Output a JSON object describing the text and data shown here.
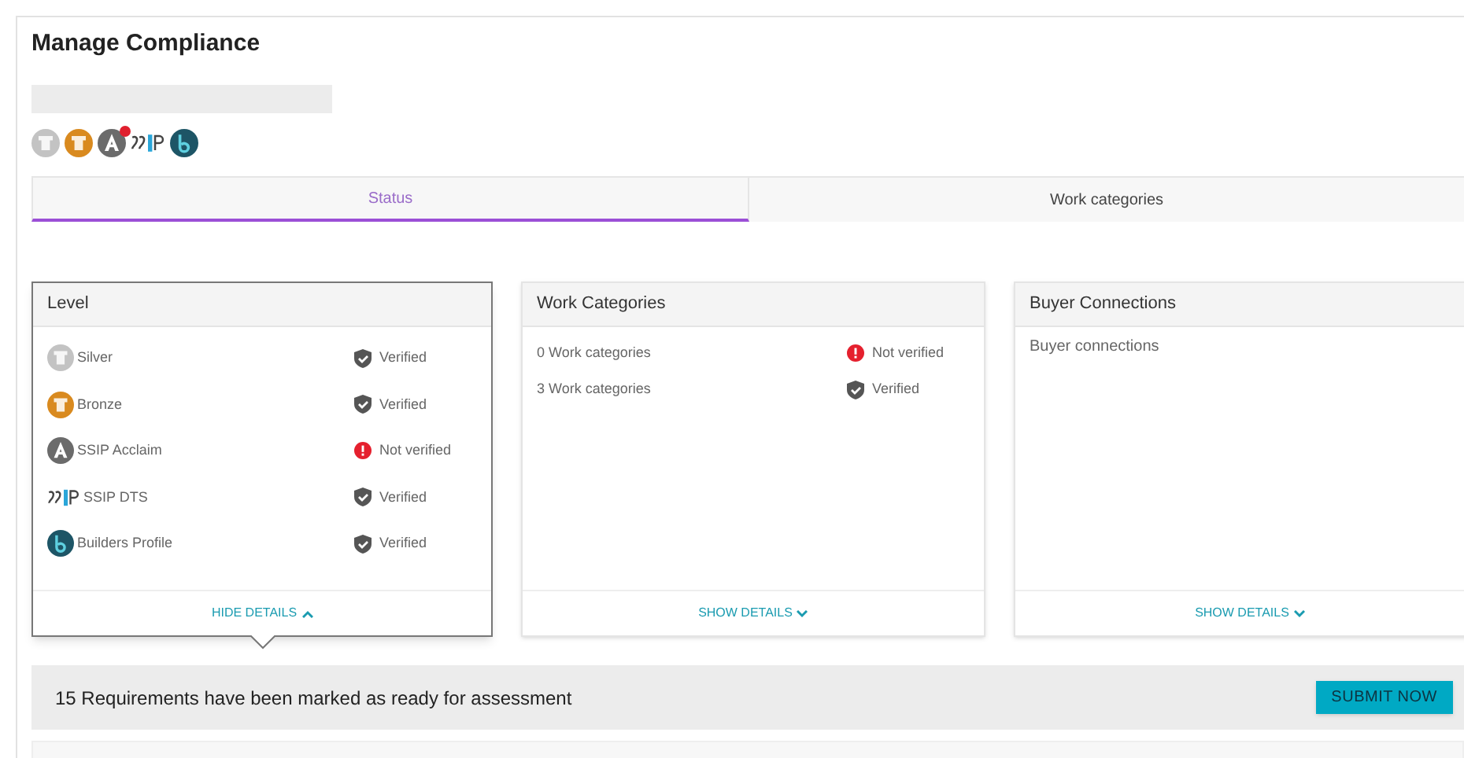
{
  "page_title": "Manage Compliance",
  "badges": [
    {
      "kind": "silver",
      "alert": false
    },
    {
      "kind": "bronze",
      "alert": false
    },
    {
      "kind": "acclaim",
      "alert": true
    },
    {
      "kind": "ssip",
      "alert": false
    },
    {
      "kind": "bp",
      "alert": false
    }
  ],
  "tabs": [
    {
      "label": "Status",
      "selected": true
    },
    {
      "label": "Work categories",
      "selected": false
    }
  ],
  "cards": [
    {
      "title": "Level",
      "expanded": true,
      "toggle": "HIDE DETAILS",
      "rows": [
        {
          "kind": "silver",
          "label": "Silver",
          "verified": true,
          "status": "Verified"
        },
        {
          "kind": "bronze",
          "label": "Bronze",
          "verified": true,
          "status": "Verified"
        },
        {
          "kind": "acclaim",
          "label": "SSIP Acclaim",
          "verified": false,
          "status": "Not verified"
        },
        {
          "kind": "ssip",
          "label": "SSIP DTS",
          "verified": true,
          "status": "Verified"
        },
        {
          "kind": "bp",
          "label": "Builders Profile",
          "verified": true,
          "status": "Verified"
        }
      ]
    },
    {
      "title": "Work Categories",
      "expanded": false,
      "toggle": "SHOW DETAILS",
      "rows": [
        {
          "label": "0 Work categories",
          "verified": false,
          "status": "Not verified"
        },
        {
          "label": "3 Work categories",
          "verified": true,
          "status": "Verified"
        }
      ]
    },
    {
      "title": "Buyer Connections",
      "expanded": false,
      "toggle": "SHOW DETAILS",
      "note": "Buyer connections"
    }
  ],
  "banner": {
    "text": "15 Requirements have been marked as ready for assessment",
    "button": "SUBMIT NOW"
  }
}
